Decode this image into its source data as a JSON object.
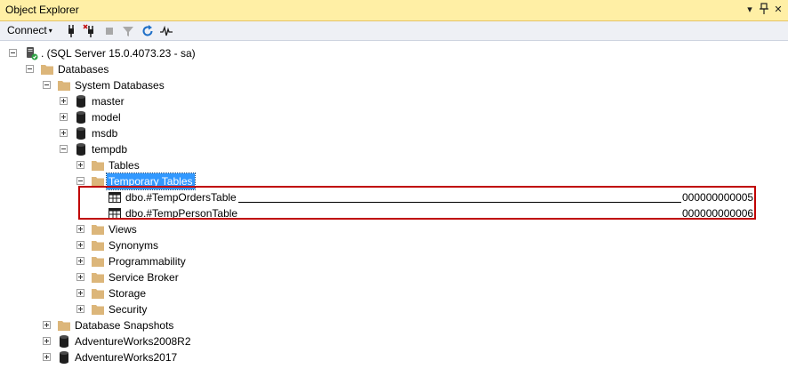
{
  "window": {
    "title": "Object Explorer",
    "pin_glyph": "▾",
    "autohide_glyph": "ᛘ",
    "close_glyph": "✕"
  },
  "toolbar": {
    "connect_label": "Connect",
    "connect_caret": "▾",
    "icons": [
      "connect-icon",
      "disconnect-icon",
      "stop-icon",
      "filter-icon",
      "refresh-icon",
      "activity-monitor-icon"
    ]
  },
  "tree": {
    "server": ". (SQL Server 15.0.4073.23 - sa)",
    "databases": "Databases",
    "system_databases": "System Databases",
    "master": "master",
    "model": "model",
    "msdb": "msdb",
    "tempdb": "tempdb",
    "tables": "Tables",
    "temporary_tables": "Temporary Tables",
    "temp_tables": [
      {
        "name": "dbo.#TempOrdersTable",
        "suffix": "000000000005"
      },
      {
        "name": "dbo.#TempPersonTable",
        "suffix": "000000000006"
      }
    ],
    "views": "Views",
    "synonyms": "Synonyms",
    "programmability": "Programmability",
    "service_broker": "Service Broker",
    "storage": "Storage",
    "security": "Security",
    "database_snapshots": "Database Snapshots",
    "aw2008r2": "AdventureWorks2008R2",
    "aw2017": "AdventureWorks2017"
  },
  "colors": {
    "title_bar": "#ffefa5",
    "selection": "#3399ff",
    "highlight_box": "#c00000",
    "folder": "#dcb67a"
  }
}
